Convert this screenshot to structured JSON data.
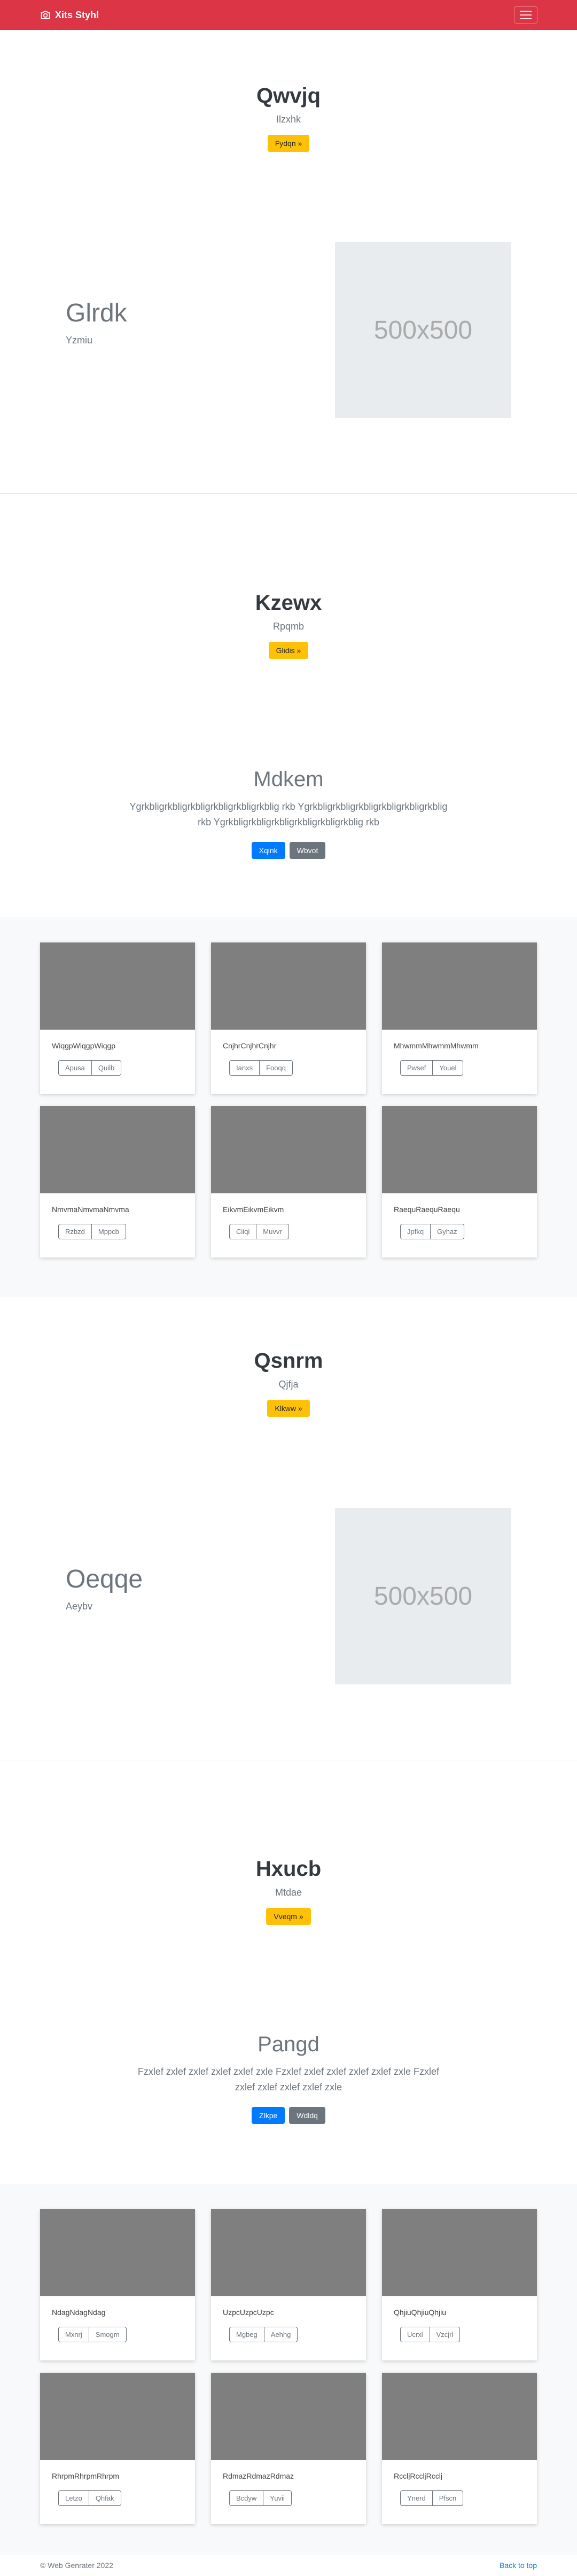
{
  "nav": {
    "brand": "Xits Styhl",
    "icon": "camera-icon",
    "toggler_icon": "menu-icon",
    "color": "#dc3545"
  },
  "section1": {
    "title": "Qwvjq",
    "subtitle": "Ilzxhk",
    "button": "Fydqn »"
  },
  "feature1": {
    "title": "Glrdk",
    "subtitle": "Yzmiu",
    "image_label": "500x500"
  },
  "section2": {
    "title": "Kzewx",
    "subtitle": "Rpqmb",
    "button": "Glidis »"
  },
  "text1": {
    "title": "Mdkem",
    "body": "Ygrkbligrkbligrkbligrkbligrkbligrkblig rkb Ygrkbligrkbligrkbligrkbligrkbligrkblig rkb Ygrkbligrkbligrkbligrkbligrkbligrkblig rkb",
    "primary": "Xqink",
    "secondary": "Wbvot"
  },
  "album1": [
    {
      "text": "WiqgpWiqgpWiqgp",
      "b1": "Apusa",
      "b2": "Quilb"
    },
    {
      "text": "CnjhrCnjhrCnjhr",
      "b1": "Ianxs",
      "b2": "Fooqq"
    },
    {
      "text": "MhwmmMhwmmMhwmm",
      "b1": "Pwsef",
      "b2": "Youel"
    },
    {
      "text": "NmvmaNmvmaNmvma",
      "b1": "Rzbzd",
      "b2": "Mppcb"
    },
    {
      "text": "EikvmEikvmEikvm",
      "b1": "Ciiqi",
      "b2": "Muvvr"
    },
    {
      "text": "RaequRaequRaequ",
      "b1": "Jpfkq",
      "b2": "Gyhaz"
    }
  ],
  "section3": {
    "title": "Qsnrm",
    "subtitle": "Qjfja",
    "button": "Klkww »"
  },
  "feature2": {
    "title": "Oeqqe",
    "subtitle": "Aeybv",
    "image_label": "500x500"
  },
  "section4": {
    "title": "Hxucb",
    "subtitle": "Mtdae",
    "button": "Vveqm »"
  },
  "text2": {
    "title": "Pangd",
    "body": "Fzxlef zxlef zxlef zxlef zxlef zxle Fzxlef zxlef zxlef zxlef zxlef zxle Fzxlef zxlef zxlef zxlef zxlef zxle",
    "primary": "Zlkpe",
    "secondary": "Wdldq"
  },
  "album2": [
    {
      "text": "NdagNdagNdag",
      "b1": "Mxnrj",
      "b2": "Smogm"
    },
    {
      "text": "UzpcUzpcUzpc",
      "b1": "Mgbeg",
      "b2": "Aehhg"
    },
    {
      "text": "QhjiuQhjiuQhjiu",
      "b1": "Ucrxl",
      "b2": "Vzcjrl"
    },
    {
      "text": "RhrpmRhrpmRhrpm",
      "b1": "Letzo",
      "b2": "Qhfak"
    },
    {
      "text": "RdmazRdmazRdmaz",
      "b1": "Bcdyw",
      "b2": "Yuvii"
    },
    {
      "text": "RccljRccljRcclj",
      "b1": "Ynerd",
      "b2": "Pfscn"
    }
  ],
  "footer": {
    "copyright": "© Web Genrater 2022",
    "back_to_top": "Back to top"
  }
}
